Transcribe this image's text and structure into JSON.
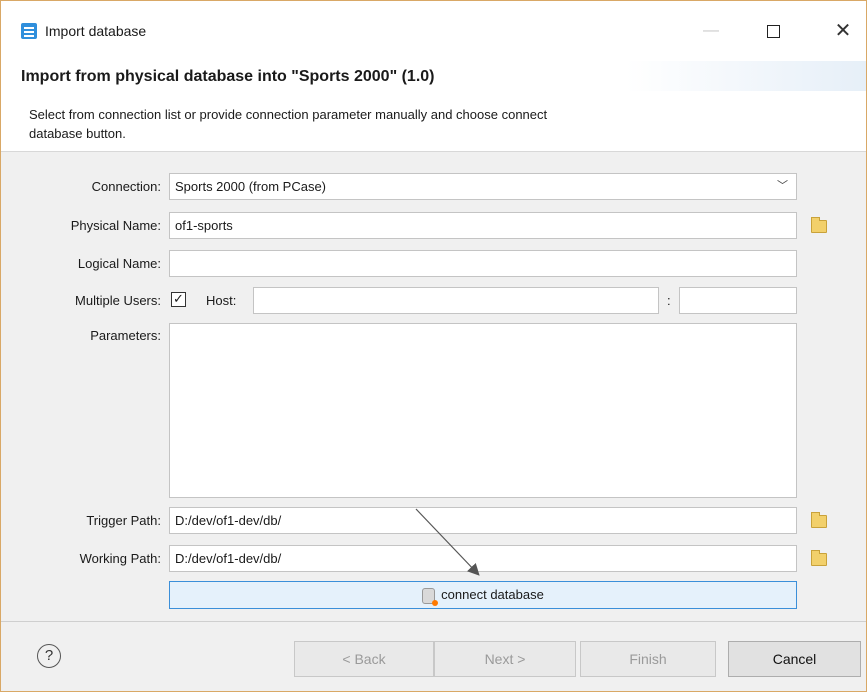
{
  "window": {
    "title": "Import database"
  },
  "header": {
    "title": "Import from physical database into \"Sports 2000\" (1.0)",
    "description": "Select from connection list or provide connection parameter manually and choose connect database button."
  },
  "form": {
    "connection_label": "Connection:",
    "connection_value": "Sports 2000 (from PCase)",
    "physical_name_label": "Physical Name:",
    "physical_name_value": "of1-sports",
    "logical_name_label": "Logical Name:",
    "logical_name_value": "",
    "multiple_users_label": "Multiple Users:",
    "multiple_users_checked": true,
    "host_label": "Host:",
    "host_value": "",
    "port_separator": ":",
    "port_value": "",
    "parameters_label": "Parameters:",
    "parameters_value": "",
    "trigger_path_label": "Trigger Path:",
    "trigger_path_value": "D:/dev/of1-dev/db/",
    "working_path_label": "Working Path:",
    "working_path_value": "D:/dev/of1-dev/db/",
    "connect_button_label": "connect database"
  },
  "footer": {
    "help_glyph": "?",
    "back_label": "< Back",
    "next_label": "Next >",
    "finish_label": "Finish",
    "cancel_label": "Cancel"
  },
  "icons": {
    "app": "database-import-icon",
    "folder": "folder-icon",
    "connect": "database-icon"
  },
  "colors": {
    "accent_border": "#3b8fd9",
    "connect_button_bg": "#e5f1fb",
    "window_border": "#d9a866"
  }
}
